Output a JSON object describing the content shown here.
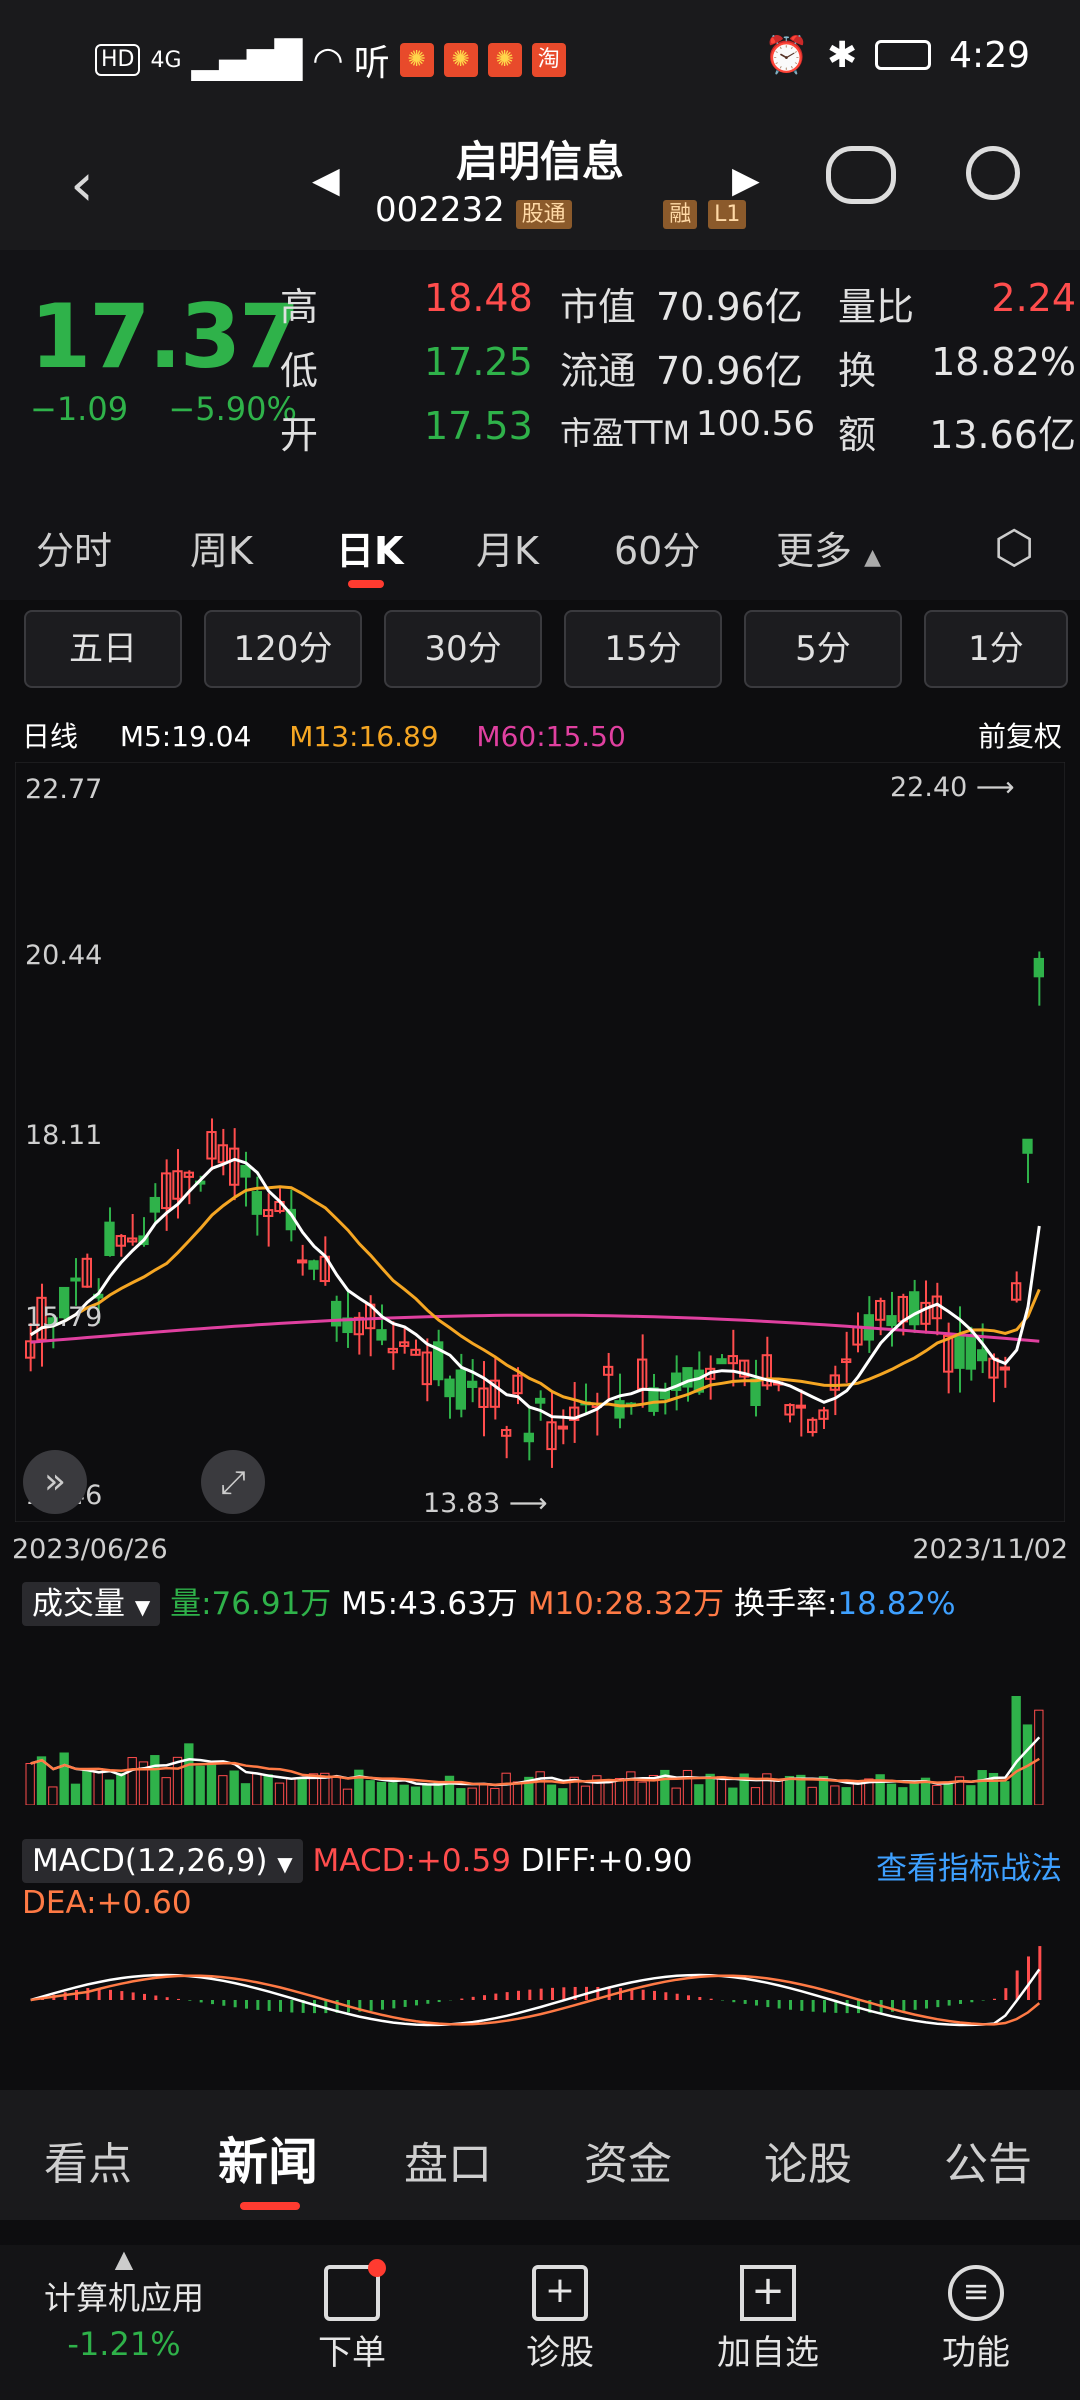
{
  "status_bar": {
    "left_hd": "HD",
    "left_net": "4G",
    "left_app": "听",
    "time": "4:29"
  },
  "header": {
    "title": "启明信息",
    "code": "002232",
    "tag_gutong": "股通",
    "tag_rong": "融",
    "tag_l1": "L1"
  },
  "quote": {
    "price": "17.37",
    "change": "−1.09",
    "change_pct": "−5.90%",
    "high_label": "高",
    "high": "18.48",
    "low_label": "低",
    "low": "17.25",
    "open_label": "开",
    "open": "17.53",
    "mktcap_label": "市值",
    "mktcap": "70.96亿",
    "float_label": "流通",
    "float": "70.96亿",
    "pe_label": "市盈TTM",
    "pe": "100.56",
    "volratio_label": "量比",
    "volratio": "2.24",
    "turnover_label": "换",
    "turnover": "18.82%",
    "amount_label": "额",
    "amount": "13.66亿"
  },
  "tabs": [
    "分时",
    "周K",
    "日K",
    "月K",
    "60分",
    "更多"
  ],
  "periods": [
    "五日",
    "120分",
    "30分",
    "15分",
    "5分",
    "1分"
  ],
  "ma_legend": {
    "label": "日线",
    "m5": "M5:19.04",
    "m13": "M13:16.89",
    "m60": "M60:15.50",
    "adjust": "前复权"
  },
  "chart": {
    "y_labels": [
      "22.77",
      "20.44",
      "18.11",
      "15.79",
      "13.46"
    ],
    "high_mark": "22.40",
    "low_mark": "13.83",
    "date_start": "2023/06/26",
    "date_end": "2023/11/02"
  },
  "volume": {
    "selector": "成交量",
    "vol": "量:76.91万",
    "m5": "M5:43.63万",
    "m10": "M10:28.32万",
    "turnover_label": "换手率:",
    "turnover": "18.82%"
  },
  "macd": {
    "selector": "MACD(12,26,9)",
    "macd": "MACD:+0.59",
    "diff": "DIFF:+0.90",
    "dea": "DEA:+0.60",
    "link": "查看指标战法"
  },
  "news_tabs": [
    "看点",
    "新闻",
    "盘口",
    "资金",
    "论股",
    "公告"
  ],
  "bottom_nav": {
    "sector": "计算机应用",
    "sector_chg": "-1.21%",
    "order": "下单",
    "diagnose": "诊股",
    "add": "加自选",
    "func": "功能"
  }
}
